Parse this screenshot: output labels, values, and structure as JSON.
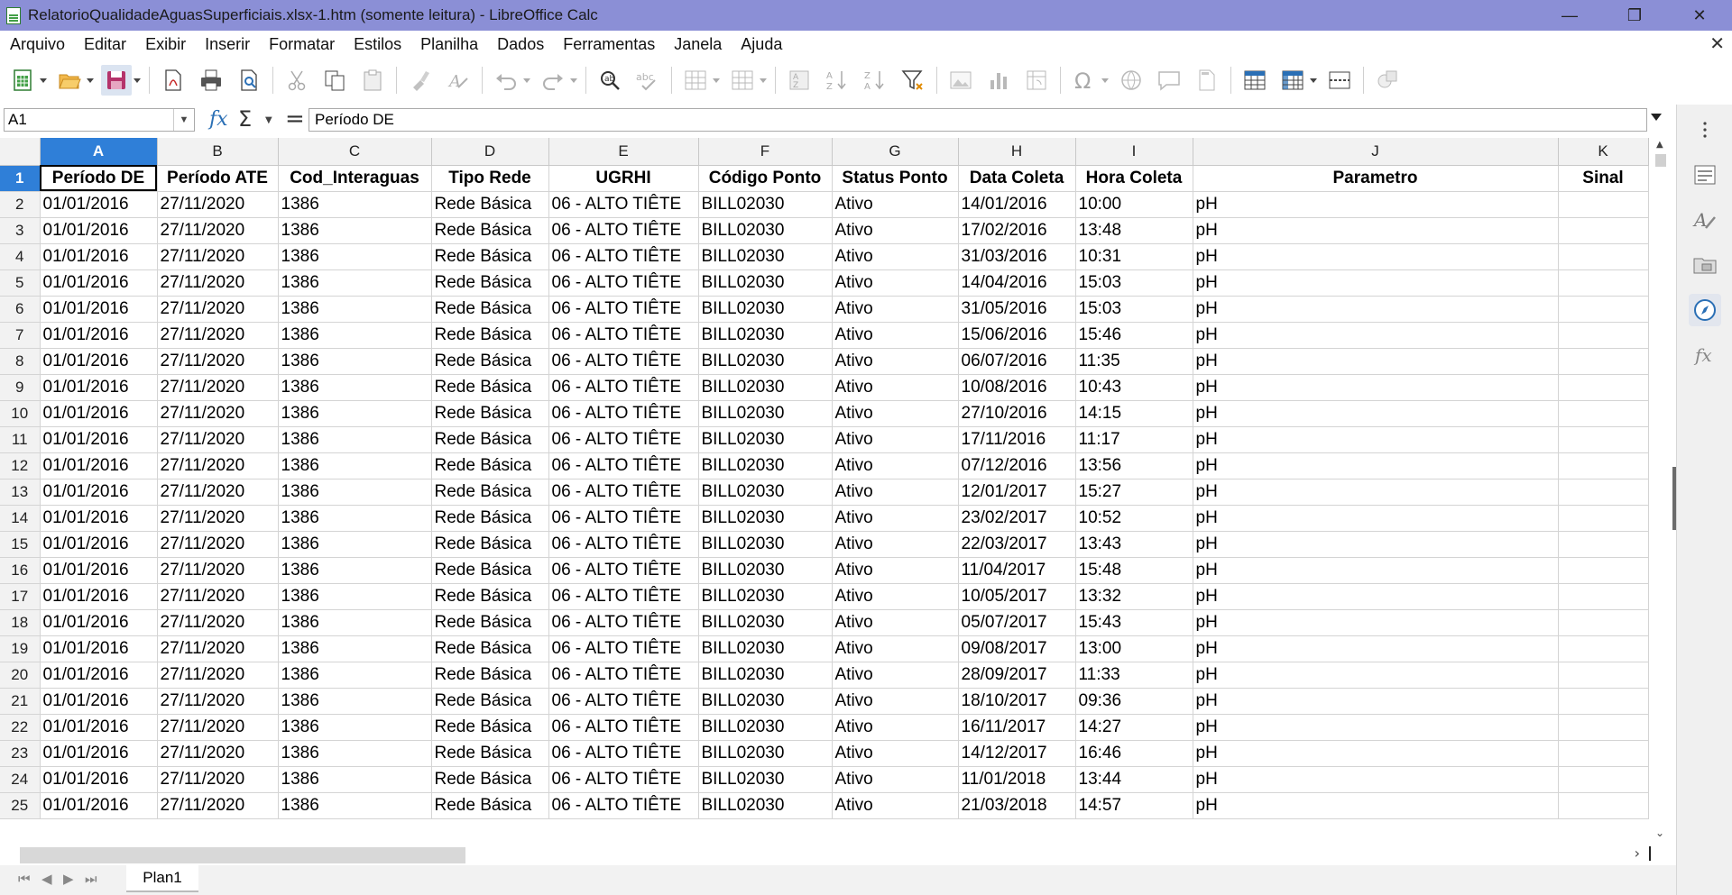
{
  "window": {
    "title": "RelatorioQualidadeAguasSuperficiais.xlsx-1.htm (somente leitura) - LibreOffice Calc",
    "minimize_label": "—",
    "restore_label": "❐",
    "close_label": "✕"
  },
  "menu": {
    "items": [
      "Arquivo",
      "Editar",
      "Exibir",
      "Inserir",
      "Formatar",
      "Estilos",
      "Planilha",
      "Dados",
      "Ferramentas",
      "Janela",
      "Ajuda"
    ],
    "close_doc_label": "✕"
  },
  "toolbar": {
    "icons": [
      "new-spreadsheet-icon",
      "open-icon",
      "save-icon",
      "export-pdf-icon",
      "print-icon",
      "print-preview-icon",
      "cut-icon",
      "copy-icon",
      "paste-icon",
      "clone-formatting-icon",
      "clear-formatting-icon",
      "undo-icon",
      "redo-icon",
      "find-replace-icon",
      "spelling-icon",
      "row-icon",
      "column-icon",
      "sort-icon",
      "sort-ascending-icon",
      "sort-descending-icon",
      "autofilter-icon",
      "image-icon",
      "chart-icon",
      "pivot-table-icon",
      "special-character-icon",
      "hyperlink-icon",
      "comment-icon",
      "headers-footers-icon",
      "define-print-area-icon",
      "freeze-rows-columns-icon",
      "split-window-icon",
      "show-draw-functions-icon"
    ]
  },
  "formula_bar": {
    "cell_ref": "A1",
    "fx_label": "fx",
    "sigma_label": "Σ",
    "equals_label": "=",
    "content": "Período DE"
  },
  "sheet": {
    "columns": [
      "A",
      "B",
      "C",
      "D",
      "E",
      "F",
      "G",
      "H",
      "I",
      "J",
      "K"
    ],
    "header_row": [
      "Período DE",
      "Período ATE",
      "Cod_Interaguas",
      "Tipo Rede",
      "UGRHI",
      "Código Ponto",
      "Status Ponto",
      "Data Coleta",
      "Hora Coleta",
      "Parametro",
      "Sinal"
    ],
    "rows": [
      [
        "01/01/2016",
        "27/11/2020",
        "1386",
        "Rede Básica",
        "06 - ALTO TIÊTE",
        "BILL02030",
        "Ativo",
        "14/01/2016",
        "10:00",
        "pH",
        ""
      ],
      [
        "01/01/2016",
        "27/11/2020",
        "1386",
        "Rede Básica",
        "06 - ALTO TIÊTE",
        "BILL02030",
        "Ativo",
        "17/02/2016",
        "13:48",
        "pH",
        ""
      ],
      [
        "01/01/2016",
        "27/11/2020",
        "1386",
        "Rede Básica",
        "06 - ALTO TIÊTE",
        "BILL02030",
        "Ativo",
        "31/03/2016",
        "10:31",
        "pH",
        ""
      ],
      [
        "01/01/2016",
        "27/11/2020",
        "1386",
        "Rede Básica",
        "06 - ALTO TIÊTE",
        "BILL02030",
        "Ativo",
        "14/04/2016",
        "15:03",
        "pH",
        ""
      ],
      [
        "01/01/2016",
        "27/11/2020",
        "1386",
        "Rede Básica",
        "06 - ALTO TIÊTE",
        "BILL02030",
        "Ativo",
        "31/05/2016",
        "15:03",
        "pH",
        ""
      ],
      [
        "01/01/2016",
        "27/11/2020",
        "1386",
        "Rede Básica",
        "06 - ALTO TIÊTE",
        "BILL02030",
        "Ativo",
        "15/06/2016",
        "15:46",
        "pH",
        ""
      ],
      [
        "01/01/2016",
        "27/11/2020",
        "1386",
        "Rede Básica",
        "06 - ALTO TIÊTE",
        "BILL02030",
        "Ativo",
        "06/07/2016",
        "11:35",
        "pH",
        ""
      ],
      [
        "01/01/2016",
        "27/11/2020",
        "1386",
        "Rede Básica",
        "06 - ALTO TIÊTE",
        "BILL02030",
        "Ativo",
        "10/08/2016",
        "10:43",
        "pH",
        ""
      ],
      [
        "01/01/2016",
        "27/11/2020",
        "1386",
        "Rede Básica",
        "06 - ALTO TIÊTE",
        "BILL02030",
        "Ativo",
        "27/10/2016",
        "14:15",
        "pH",
        ""
      ],
      [
        "01/01/2016",
        "27/11/2020",
        "1386",
        "Rede Básica",
        "06 - ALTO TIÊTE",
        "BILL02030",
        "Ativo",
        "17/11/2016",
        "11:17",
        "pH",
        ""
      ],
      [
        "01/01/2016",
        "27/11/2020",
        "1386",
        "Rede Básica",
        "06 - ALTO TIÊTE",
        "BILL02030",
        "Ativo",
        "07/12/2016",
        "13:56",
        "pH",
        ""
      ],
      [
        "01/01/2016",
        "27/11/2020",
        "1386",
        "Rede Básica",
        "06 - ALTO TIÊTE",
        "BILL02030",
        "Ativo",
        "12/01/2017",
        "15:27",
        "pH",
        ""
      ],
      [
        "01/01/2016",
        "27/11/2020",
        "1386",
        "Rede Básica",
        "06 - ALTO TIÊTE",
        "BILL02030",
        "Ativo",
        "23/02/2017",
        "10:52",
        "pH",
        ""
      ],
      [
        "01/01/2016",
        "27/11/2020",
        "1386",
        "Rede Básica",
        "06 - ALTO TIÊTE",
        "BILL02030",
        "Ativo",
        "22/03/2017",
        "13:43",
        "pH",
        ""
      ],
      [
        "01/01/2016",
        "27/11/2020",
        "1386",
        "Rede Básica",
        "06 - ALTO TIÊTE",
        "BILL02030",
        "Ativo",
        "11/04/2017",
        "15:48",
        "pH",
        ""
      ],
      [
        "01/01/2016",
        "27/11/2020",
        "1386",
        "Rede Básica",
        "06 - ALTO TIÊTE",
        "BILL02030",
        "Ativo",
        "10/05/2017",
        "13:32",
        "pH",
        ""
      ],
      [
        "01/01/2016",
        "27/11/2020",
        "1386",
        "Rede Básica",
        "06 - ALTO TIÊTE",
        "BILL02030",
        "Ativo",
        "05/07/2017",
        "15:43",
        "pH",
        ""
      ],
      [
        "01/01/2016",
        "27/11/2020",
        "1386",
        "Rede Básica",
        "06 - ALTO TIÊTE",
        "BILL02030",
        "Ativo",
        "09/08/2017",
        "13:00",
        "pH",
        ""
      ],
      [
        "01/01/2016",
        "27/11/2020",
        "1386",
        "Rede Básica",
        "06 - ALTO TIÊTE",
        "BILL02030",
        "Ativo",
        "28/09/2017",
        "11:33",
        "pH",
        ""
      ],
      [
        "01/01/2016",
        "27/11/2020",
        "1386",
        "Rede Básica",
        "06 - ALTO TIÊTE",
        "BILL02030",
        "Ativo",
        "18/10/2017",
        "09:36",
        "pH",
        ""
      ],
      [
        "01/01/2016",
        "27/11/2020",
        "1386",
        "Rede Básica",
        "06 - ALTO TIÊTE",
        "BILL02030",
        "Ativo",
        "16/11/2017",
        "14:27",
        "pH",
        ""
      ],
      [
        "01/01/2016",
        "27/11/2020",
        "1386",
        "Rede Básica",
        "06 - ALTO TIÊTE",
        "BILL02030",
        "Ativo",
        "14/12/2017",
        "16:46",
        "pH",
        ""
      ],
      [
        "01/01/2016",
        "27/11/2020",
        "1386",
        "Rede Básica",
        "06 - ALTO TIÊTE",
        "BILL02030",
        "Ativo",
        "11/01/2018",
        "13:44",
        "pH",
        ""
      ],
      [
        "01/01/2016",
        "27/11/2020",
        "1386",
        "Rede Básica",
        "06 - ALTO TIÊTE",
        "BILL02030",
        "Ativo",
        "21/03/2018",
        "14:57",
        "pH",
        ""
      ]
    ],
    "tab_name": "Plan1"
  },
  "sidebar": {
    "icons": [
      "properties-icon",
      "styles-icon",
      "gallery-icon",
      "navigator-icon",
      "functions-icon"
    ],
    "active": "navigator-icon"
  },
  "colors": {
    "titlebar_bg": "#8b8fd6",
    "selection_blue": "#2f7fd8",
    "header_bg": "#f2f2f2",
    "grid_line": "#d4d4d4"
  }
}
